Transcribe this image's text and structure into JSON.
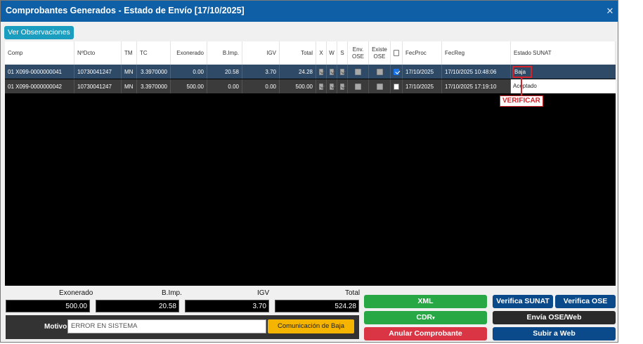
{
  "window": {
    "title": "Comprobantes Generados - Estado de Envío [17/10/2025]",
    "close_glyph": "✕"
  },
  "toolbar": {
    "observaciones_label": "Ver Observaciones"
  },
  "table": {
    "headers": {
      "comp": "Comp",
      "ndcto": "NºDcto",
      "tm": "TM",
      "tc": "TC",
      "exonerado": "Exonerado",
      "bimp": "B.Imp.",
      "igv": "IGV",
      "total": "Total",
      "x": "X",
      "w": "W",
      "s": "S",
      "env_ose_1": "Env.",
      "env_ose_2": "OSE",
      "existe_ose_1": "Existe",
      "existe_ose_2": "OSE",
      "fecproc": "FecProc",
      "fecreg": "FecReg",
      "estado": "Estado SUNAT"
    },
    "rows": [
      {
        "comp": "01 X099-0000000041",
        "ndcto": "10730041247",
        "tm": "MN",
        "tc": "3.3970000",
        "exonerado": "0.00",
        "bimp": "20.58",
        "igv": "3.70",
        "total": "24.28",
        "x": true,
        "w": true,
        "s": true,
        "env_ose": false,
        "existe_ose": false,
        "selected": true,
        "fecproc": "17/10/2025",
        "fecreg": "17/10/2025 10:48:06",
        "estado": "Baja"
      },
      {
        "comp": "01 X099-0000000042",
        "ndcto": "10730041247",
        "tm": "MN",
        "tc": "3.3970000",
        "exonerado": "500.00",
        "bimp": "0.00",
        "igv": "0.00",
        "total": "500.00",
        "x": true,
        "w": true,
        "s": true,
        "env_ose": false,
        "existe_ose": false,
        "selected": false,
        "fecproc": "17/10/2025",
        "fecreg": "17/10/2025 17:19:10",
        "estado": "Aceptado"
      }
    ]
  },
  "annotation": {
    "label": "VERIFICAR",
    "color": "#d3242b"
  },
  "totals": {
    "exonerado_label": "Exonerado",
    "exonerado_value": "500.00",
    "bimp_label": "B.Imp.",
    "bimp_value": "20.58",
    "igv_label": "IGV",
    "igv_value": "3.70",
    "total_label": "Total",
    "total_value": "524.28"
  },
  "motivo": {
    "label": "Motivo",
    "value": "ERROR EN SISTEMA",
    "comunicacion_baja_label": "Comunicación de Baja"
  },
  "actions": {
    "xml": "XML",
    "cdr": "CDR",
    "cdr_caret": "▾",
    "anular": "Anular Comprobante",
    "verifica_sunat": "Verifica SUNAT",
    "verifica_ose": "Verifica OSE",
    "envia_ose_web": "Envía OSE/Web",
    "subir_web": "Subir a Web"
  },
  "colors": {
    "titlebar": "#0e5fa6",
    "accent_green": "#27a844",
    "accent_red": "#d93545",
    "accent_navy": "#0b4a8a",
    "accent_yellow": "#f5b400",
    "accent_teal": "#1a9dbf"
  }
}
